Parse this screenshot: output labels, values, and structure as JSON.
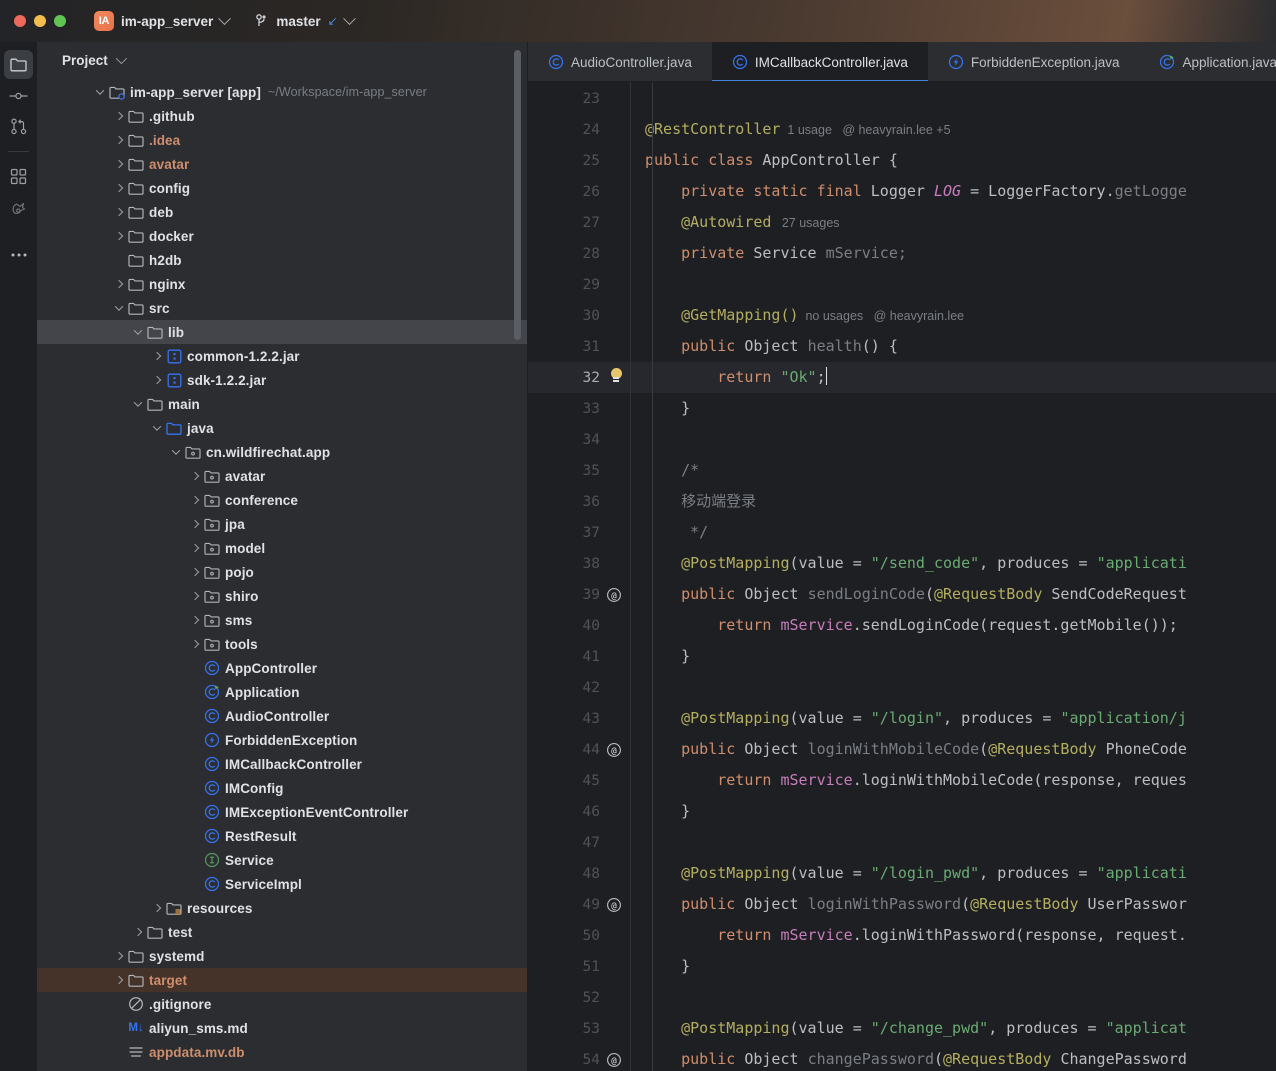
{
  "titlebar": {
    "app_badge": "IA",
    "project_name": "im-app_server",
    "branch_name": "master",
    "branch_arrow": "↙",
    "window_controls": [
      "close",
      "minimize",
      "maximize"
    ]
  },
  "toolstrip": {
    "items": [
      {
        "name": "project",
        "icon": "folder-icon",
        "active": true
      },
      {
        "name": "commit",
        "icon": "commit-icon",
        "active": false
      },
      {
        "name": "pull-requests",
        "icon": "pull-request-icon",
        "active": false
      },
      {
        "name": "structure",
        "icon": "structure-icon",
        "active": false
      },
      {
        "name": "ai-assistant",
        "icon": "ai-bird-icon",
        "active": false
      },
      {
        "name": "more",
        "icon": "more-dots-icon",
        "active": false
      }
    ]
  },
  "project_panel": {
    "title": "Project",
    "tree": [
      {
        "indent": 0,
        "arrow": "down",
        "icon": "module-folder-icon",
        "label": "im-app_server [app]",
        "sub": "~/Workspace/im-app_server",
        "state": "normal"
      },
      {
        "indent": 1,
        "arrow": "right",
        "icon": "folder-icon",
        "label": ".github",
        "state": "normal"
      },
      {
        "indent": 1,
        "arrow": "right",
        "icon": "folder-icon",
        "label": ".idea",
        "state": "excluded"
      },
      {
        "indent": 1,
        "arrow": "right",
        "icon": "folder-icon",
        "label": "avatar",
        "state": "excluded"
      },
      {
        "indent": 1,
        "arrow": "right",
        "icon": "folder-icon",
        "label": "config",
        "state": "normal"
      },
      {
        "indent": 1,
        "arrow": "right",
        "icon": "folder-icon",
        "label": "deb",
        "state": "normal"
      },
      {
        "indent": 1,
        "arrow": "right",
        "icon": "folder-icon",
        "label": "docker",
        "state": "normal"
      },
      {
        "indent": 1,
        "arrow": "none",
        "icon": "folder-icon",
        "label": "h2db",
        "state": "normal"
      },
      {
        "indent": 1,
        "arrow": "right",
        "icon": "folder-icon",
        "label": "nginx",
        "state": "normal"
      },
      {
        "indent": 1,
        "arrow": "down",
        "icon": "folder-icon",
        "label": "src",
        "state": "normal"
      },
      {
        "indent": 2,
        "arrow": "down",
        "icon": "folder-icon",
        "label": "lib",
        "state": "selected"
      },
      {
        "indent": 3,
        "arrow": "right",
        "icon": "jar-icon",
        "label": "common-1.2.2.jar",
        "state": "normal"
      },
      {
        "indent": 3,
        "arrow": "right",
        "icon": "jar-icon",
        "label": "sdk-1.2.2.jar",
        "state": "normal"
      },
      {
        "indent": 2,
        "arrow": "down",
        "icon": "folder-icon",
        "label": "main",
        "state": "normal"
      },
      {
        "indent": 3,
        "arrow": "down",
        "icon": "source-root-icon",
        "label": "java",
        "state": "normal"
      },
      {
        "indent": 4,
        "arrow": "down",
        "icon": "package-icon",
        "label": "cn.wildfirechat.app",
        "state": "normal"
      },
      {
        "indent": 5,
        "arrow": "right",
        "icon": "package-icon",
        "label": "avatar",
        "state": "normal"
      },
      {
        "indent": 5,
        "arrow": "right",
        "icon": "package-icon",
        "label": "conference",
        "state": "normal"
      },
      {
        "indent": 5,
        "arrow": "right",
        "icon": "package-icon",
        "label": "jpa",
        "state": "normal"
      },
      {
        "indent": 5,
        "arrow": "right",
        "icon": "package-icon",
        "label": "model",
        "state": "normal"
      },
      {
        "indent": 5,
        "arrow": "right",
        "icon": "package-icon",
        "label": "pojo",
        "state": "normal"
      },
      {
        "indent": 5,
        "arrow": "right",
        "icon": "package-icon",
        "label": "shiro",
        "state": "normal"
      },
      {
        "indent": 5,
        "arrow": "right",
        "icon": "package-icon",
        "label": "sms",
        "state": "normal"
      },
      {
        "indent": 5,
        "arrow": "right",
        "icon": "package-icon",
        "label": "tools",
        "state": "normal"
      },
      {
        "indent": 5,
        "arrow": "none",
        "icon": "java-class-icon",
        "label": "AppController",
        "state": "normal"
      },
      {
        "indent": 5,
        "arrow": "none",
        "icon": "java-runnable-class-icon",
        "label": "Application",
        "state": "normal"
      },
      {
        "indent": 5,
        "arrow": "none",
        "icon": "java-class-icon",
        "label": "AudioController",
        "state": "normal"
      },
      {
        "indent": 5,
        "arrow": "none",
        "icon": "java-exception-icon",
        "label": "ForbiddenException",
        "state": "normal"
      },
      {
        "indent": 5,
        "arrow": "none",
        "icon": "java-class-icon",
        "label": "IMCallbackController",
        "state": "normal"
      },
      {
        "indent": 5,
        "arrow": "none",
        "icon": "java-class-icon",
        "label": "IMConfig",
        "state": "normal"
      },
      {
        "indent": 5,
        "arrow": "none",
        "icon": "java-class-icon",
        "label": "IMExceptionEventController",
        "state": "normal"
      },
      {
        "indent": 5,
        "arrow": "none",
        "icon": "java-class-icon",
        "label": "RestResult",
        "state": "normal"
      },
      {
        "indent": 5,
        "arrow": "none",
        "icon": "java-interface-icon",
        "label": "Service",
        "state": "normal"
      },
      {
        "indent": 5,
        "arrow": "none",
        "icon": "java-class-icon",
        "label": "ServiceImpl",
        "state": "normal"
      },
      {
        "indent": 3,
        "arrow": "right",
        "icon": "resource-root-icon",
        "label": "resources",
        "state": "normal"
      },
      {
        "indent": 2,
        "arrow": "right",
        "icon": "folder-icon",
        "label": "test",
        "state": "normal"
      },
      {
        "indent": 1,
        "arrow": "right",
        "icon": "folder-icon",
        "label": "systemd",
        "state": "normal"
      },
      {
        "indent": 1,
        "arrow": "right",
        "icon": "folder-icon",
        "label": "target",
        "state": "found"
      },
      {
        "indent": 1,
        "arrow": "none",
        "icon": "gitignore-icon",
        "label": ".gitignore",
        "state": "normal"
      },
      {
        "indent": 1,
        "arrow": "none",
        "icon": "markdown-icon",
        "label": "aliyun_sms.md",
        "state": "normal"
      },
      {
        "indent": 1,
        "arrow": "none",
        "icon": "db-file-icon",
        "label": "appdata.mv.db",
        "state": "excluded"
      }
    ]
  },
  "editor": {
    "tabs": [
      {
        "label": "AudioController.java",
        "icon": "java-class-icon",
        "active": false
      },
      {
        "label": "IMCallbackController.java",
        "icon": "java-class-icon",
        "active": true
      },
      {
        "label": "ForbiddenException.java",
        "icon": "java-exception-icon",
        "active": false
      },
      {
        "label": "Application.java",
        "icon": "java-runnable-class-icon",
        "active": false
      }
    ],
    "first_line_number": 23,
    "current_line": 32,
    "lines": [
      {
        "n": 23,
        "mark": "",
        "tokens": []
      },
      {
        "n": 24,
        "mark": "",
        "tokens": [
          {
            "t": "ann",
            "v": "@RestController"
          },
          {
            "t": "hint",
            "v": "  1 usage   @ heavyrain.lee +5"
          }
        ]
      },
      {
        "n": 25,
        "mark": "",
        "tokens": [
          {
            "t": "kw",
            "v": "public class "
          },
          {
            "t": "cls",
            "v": "AppController"
          },
          {
            "t": "id",
            "v": " {"
          }
        ]
      },
      {
        "n": 26,
        "mark": "",
        "tokens": [
          {
            "t": "id",
            "v": "    "
          },
          {
            "t": "kw",
            "v": "private static final "
          },
          {
            "t": "cls",
            "v": "Logger "
          },
          {
            "t": "stat",
            "v": "LOG"
          },
          {
            "t": "id",
            "v": " = LoggerFactory."
          },
          {
            "t": "meth",
            "v": "getLogge"
          }
        ]
      },
      {
        "n": 27,
        "mark": "",
        "tokens": [
          {
            "t": "id",
            "v": "    "
          },
          {
            "t": "ann",
            "v": "@Autowired"
          },
          {
            "t": "hint",
            "v": "   27 usages"
          }
        ]
      },
      {
        "n": 28,
        "mark": "",
        "tokens": [
          {
            "t": "id",
            "v": "    "
          },
          {
            "t": "kw",
            "v": "private "
          },
          {
            "t": "cls",
            "v": "Service "
          },
          {
            "t": "meth",
            "v": "mService;"
          }
        ]
      },
      {
        "n": 29,
        "mark": "",
        "tokens": []
      },
      {
        "n": 30,
        "mark": "",
        "tokens": [
          {
            "t": "id",
            "v": "    "
          },
          {
            "t": "ann",
            "v": "@GetMapping()"
          },
          {
            "t": "hint",
            "v": "  no usages   @ heavyrain.lee"
          }
        ]
      },
      {
        "n": 31,
        "mark": "",
        "tokens": [
          {
            "t": "id",
            "v": "    "
          },
          {
            "t": "kw",
            "v": "public "
          },
          {
            "t": "cls",
            "v": "Object "
          },
          {
            "t": "meth",
            "v": "health"
          },
          {
            "t": "id",
            "v": "() {"
          }
        ]
      },
      {
        "n": 32,
        "mark": "bulb",
        "tokens": [
          {
            "t": "id",
            "v": "        "
          },
          {
            "t": "kw",
            "v": "return "
          },
          {
            "t": "str",
            "v": "\"Ok\""
          },
          {
            "t": "id",
            "v": ";"
          },
          {
            "t": "caret",
            "v": ""
          }
        ]
      },
      {
        "n": 33,
        "mark": "",
        "tokens": [
          {
            "t": "id",
            "v": "    }"
          }
        ]
      },
      {
        "n": 34,
        "mark": "",
        "tokens": []
      },
      {
        "n": 35,
        "mark": "",
        "tokens": [
          {
            "t": "cmt",
            "v": "    /*"
          }
        ]
      },
      {
        "n": 36,
        "mark": "",
        "tokens": [
          {
            "t": "cmt",
            "v": "    移动端登录"
          }
        ]
      },
      {
        "n": 37,
        "mark": "",
        "tokens": [
          {
            "t": "cmt",
            "v": "     */"
          }
        ]
      },
      {
        "n": 38,
        "mark": "",
        "tokens": [
          {
            "t": "id",
            "v": "    "
          },
          {
            "t": "ann",
            "v": "@PostMapping"
          },
          {
            "t": "id",
            "v": "(value = "
          },
          {
            "t": "str",
            "v": "\"/send_code\""
          },
          {
            "t": "id",
            "v": ", produces = "
          },
          {
            "t": "str",
            "v": "\"applicati"
          }
        ]
      },
      {
        "n": 39,
        "mark": "@",
        "tokens": [
          {
            "t": "id",
            "v": "    "
          },
          {
            "t": "kw",
            "v": "public "
          },
          {
            "t": "cls",
            "v": "Object "
          },
          {
            "t": "meth",
            "v": "sendLoginCode"
          },
          {
            "t": "id",
            "v": "("
          },
          {
            "t": "ann",
            "v": "@RequestBody "
          },
          {
            "t": "cls",
            "v": "SendCodeRequest"
          }
        ]
      },
      {
        "n": 40,
        "mark": "",
        "tokens": [
          {
            "t": "id",
            "v": "        "
          },
          {
            "t": "kw",
            "v": "return "
          },
          {
            "t": "fld",
            "v": "mService"
          },
          {
            "t": "id",
            "v": ".sendLoginCode(request.getMobile());"
          }
        ]
      },
      {
        "n": 41,
        "mark": "",
        "tokens": [
          {
            "t": "id",
            "v": "    }"
          }
        ]
      },
      {
        "n": 42,
        "mark": "",
        "tokens": []
      },
      {
        "n": 43,
        "mark": "",
        "tokens": [
          {
            "t": "id",
            "v": "    "
          },
          {
            "t": "ann",
            "v": "@PostMapping"
          },
          {
            "t": "id",
            "v": "(value = "
          },
          {
            "t": "str",
            "v": "\"/login\""
          },
          {
            "t": "id",
            "v": ", produces = "
          },
          {
            "t": "str",
            "v": "\"application/j"
          }
        ]
      },
      {
        "n": 44,
        "mark": "@",
        "tokens": [
          {
            "t": "id",
            "v": "    "
          },
          {
            "t": "kw",
            "v": "public "
          },
          {
            "t": "cls",
            "v": "Object "
          },
          {
            "t": "meth",
            "v": "loginWithMobileCode"
          },
          {
            "t": "id",
            "v": "("
          },
          {
            "t": "ann",
            "v": "@RequestBody "
          },
          {
            "t": "cls",
            "v": "PhoneCode"
          }
        ]
      },
      {
        "n": 45,
        "mark": "",
        "tokens": [
          {
            "t": "id",
            "v": "        "
          },
          {
            "t": "kw",
            "v": "return "
          },
          {
            "t": "fld",
            "v": "mService"
          },
          {
            "t": "id",
            "v": ".loginWithMobileCode(response, reques"
          }
        ]
      },
      {
        "n": 46,
        "mark": "",
        "tokens": [
          {
            "t": "id",
            "v": "    }"
          }
        ]
      },
      {
        "n": 47,
        "mark": "",
        "tokens": []
      },
      {
        "n": 48,
        "mark": "",
        "tokens": [
          {
            "t": "id",
            "v": "    "
          },
          {
            "t": "ann",
            "v": "@PostMapping"
          },
          {
            "t": "id",
            "v": "(value = "
          },
          {
            "t": "str",
            "v": "\"/login_pwd\""
          },
          {
            "t": "id",
            "v": ", produces = "
          },
          {
            "t": "str",
            "v": "\"applicati"
          }
        ]
      },
      {
        "n": 49,
        "mark": "@",
        "tokens": [
          {
            "t": "id",
            "v": "    "
          },
          {
            "t": "kw",
            "v": "public "
          },
          {
            "t": "cls",
            "v": "Object "
          },
          {
            "t": "meth",
            "v": "loginWithPassword"
          },
          {
            "t": "id",
            "v": "("
          },
          {
            "t": "ann",
            "v": "@RequestBody "
          },
          {
            "t": "cls",
            "v": "UserPasswor"
          }
        ]
      },
      {
        "n": 50,
        "mark": "",
        "tokens": [
          {
            "t": "id",
            "v": "        "
          },
          {
            "t": "kw",
            "v": "return "
          },
          {
            "t": "fld",
            "v": "mService"
          },
          {
            "t": "id",
            "v": ".loginWithPassword(response, request."
          }
        ]
      },
      {
        "n": 51,
        "mark": "",
        "tokens": [
          {
            "t": "id",
            "v": "    }"
          }
        ]
      },
      {
        "n": 52,
        "mark": "",
        "tokens": []
      },
      {
        "n": 53,
        "mark": "",
        "tokens": [
          {
            "t": "id",
            "v": "    "
          },
          {
            "t": "ann",
            "v": "@PostMapping"
          },
          {
            "t": "id",
            "v": "(value = "
          },
          {
            "t": "str",
            "v": "\"/change_pwd\""
          },
          {
            "t": "id",
            "v": ", produces = "
          },
          {
            "t": "str",
            "v": "\"applicat"
          }
        ]
      },
      {
        "n": 54,
        "mark": "@",
        "tokens": [
          {
            "t": "id",
            "v": "    "
          },
          {
            "t": "kw",
            "v": "public "
          },
          {
            "t": "cls",
            "v": "Object "
          },
          {
            "t": "meth",
            "v": "changePassword"
          },
          {
            "t": "id",
            "v": "("
          },
          {
            "t": "ann",
            "v": "@RequestBody "
          },
          {
            "t": "cls",
            "v": "ChangePassword"
          }
        ]
      }
    ]
  },
  "colors": {
    "editor_bg": "#1e1f22",
    "panel_bg": "#2b2d30",
    "selection": "#43454a",
    "found_highlight": "#45332a",
    "accent_blue": "#4682d9",
    "keyword": "#cf8e6d",
    "annotation": "#b3ae60",
    "string": "#6aab73",
    "field": "#c77dbb",
    "comment": "#7a7e85",
    "excluded_text": "#cf8e6d"
  }
}
